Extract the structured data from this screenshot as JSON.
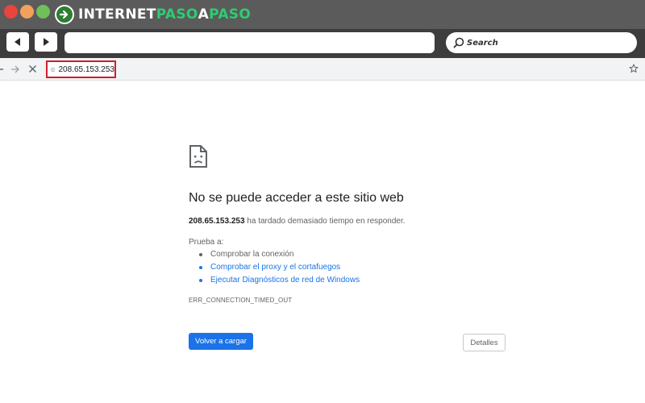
{
  "brand": {
    "part1": "INTERNET",
    "part2": "PASO",
    "part3": "A",
    "part4": "PASO"
  },
  "outer_toolbar": {
    "search_label": "Search"
  },
  "address_bar": {
    "url": "208.65.153.253"
  },
  "error": {
    "title": "No se puede acceder a este sitio web",
    "host": "208.65.153.253",
    "message": "ha tardado demasiado tiempo en responder.",
    "try_label": "Prueba a:",
    "suggestions": [
      "Comprobar la conexión",
      "Comprobar el proxy y el cortafuegos",
      "Ejecutar Diagnósticos de red de Windows"
    ],
    "code": "ERR_CONNECTION_TIMED_OUT",
    "reload_label": "Volver a cargar",
    "details_label": "Detalles"
  },
  "colors": {
    "accent_blue": "#1a73e8",
    "highlight_red": "#d01e2a",
    "brand_green": "#2ecc71"
  },
  "icons": [
    "back-arrow-icon",
    "forward-arrow-icon",
    "search-icon",
    "stop-icon",
    "info-icon",
    "star-icon",
    "sad-page-icon"
  ]
}
